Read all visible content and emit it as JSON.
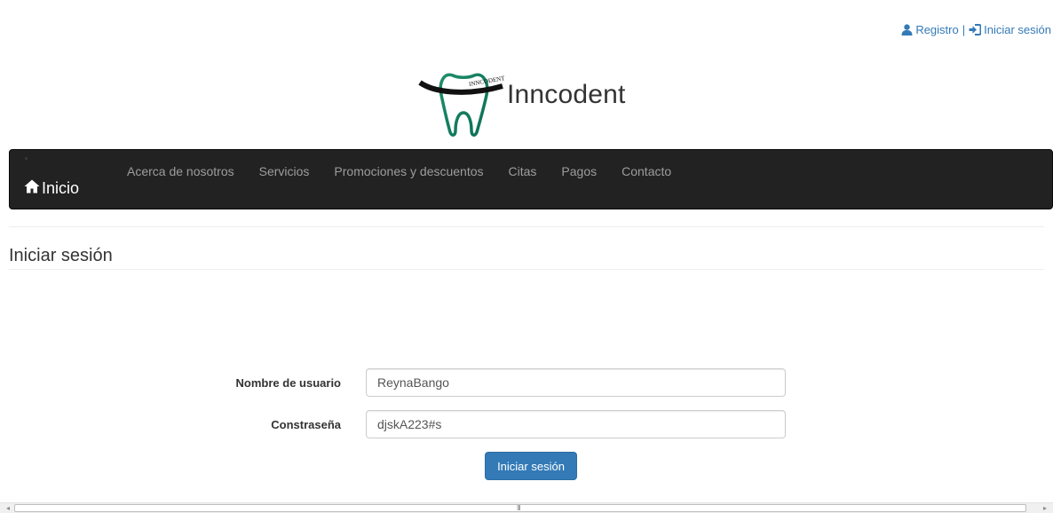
{
  "header": {
    "register_label": "Registro",
    "separator": "|",
    "login_label": "Iniciar sesión",
    "register_icon": "user-icon",
    "login_icon": "sign-in-icon",
    "link_color": "#337ab7"
  },
  "logo": {
    "brand_name": "Inncodent",
    "arc_text": "INNCODENT"
  },
  "navbar": {
    "brand_label": "Inicio",
    "brand_icon": "home-icon",
    "background": "#222222",
    "items": [
      {
        "label": "Acerca de nosotros"
      },
      {
        "label": "Servicios"
      },
      {
        "label": "Promociones y descuentos"
      },
      {
        "label": "Citas"
      },
      {
        "label": "Pagos"
      },
      {
        "label": "Contacto"
      }
    ]
  },
  "page": {
    "title": "Iniciar sesión"
  },
  "form": {
    "username_label": "Nombre de usuario",
    "username_value": "ReynaBango",
    "password_label": "Constraseña",
    "password_value": "djskA223#s",
    "submit_label": "Iniciar sesión",
    "button_color": "#337ab7"
  },
  "scrollbar": {
    "left_arrow": "◂",
    "right_arrow": "▸",
    "grip": "III"
  }
}
